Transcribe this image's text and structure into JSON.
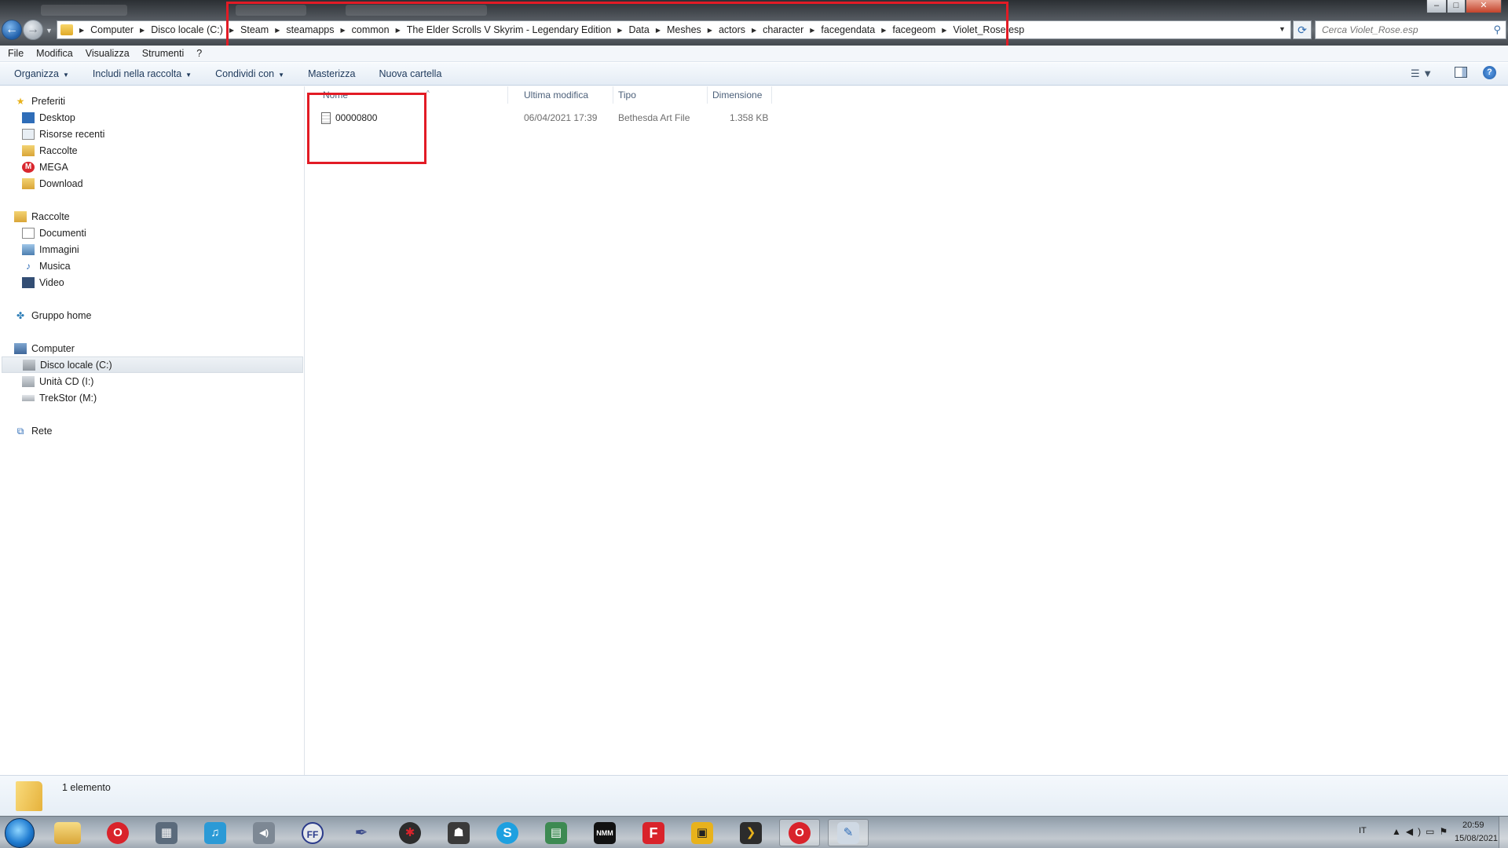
{
  "window": {
    "minimize": "–",
    "maximize": "□",
    "close": "✕"
  },
  "address": {
    "crumbs": [
      "Computer",
      "Disco locale (C:)",
      "Steam",
      "steamapps",
      "common",
      "The Elder Scrolls V Skyrim - Legendary Edition",
      "Data",
      "Meshes",
      "actors",
      "character",
      "facegendata",
      "facegeom",
      "Violet_Rose.esp"
    ],
    "search_placeholder": "Cerca Violet_Rose.esp"
  },
  "menu": [
    "File",
    "Modifica",
    "Visualizza",
    "Strumenti",
    "?"
  ],
  "commands": {
    "organize": "Organizza",
    "include": "Includi nella raccolta",
    "share": "Condividi con",
    "burn": "Masterizza",
    "new_folder": "Nuova cartella"
  },
  "nav": {
    "favorites": "Preferiti",
    "fav_items": [
      "Desktop",
      "Risorse recenti",
      "Raccolte",
      "MEGA",
      "Download"
    ],
    "libraries": "Raccolte",
    "lib_items": [
      "Documenti",
      "Immagini",
      "Musica",
      "Video"
    ],
    "homegroup": "Gruppo home",
    "computer": "Computer",
    "drives": [
      "Disco locale (C:)",
      "Unità CD (I:)",
      "TrekStor (M:)"
    ],
    "network": "Rete"
  },
  "columns": [
    "Nome",
    "Ultima modifica",
    "Tipo",
    "Dimensione"
  ],
  "files": [
    {
      "name": "00000800",
      "modified": "06/04/2021 17:39",
      "type": "Bethesda Art File",
      "size": "1.358 KB"
    }
  ],
  "status": {
    "count": "1 elemento"
  },
  "taskbar": {
    "lang": "IT",
    "time": "20:59",
    "date": "15/08/2021",
    "apps": [
      "opera-icon",
      "media-player-icon",
      "music-icon",
      "speaker-icon",
      "ffdec-icon",
      "feather-icon",
      "spider-icon",
      "figures-icon",
      "skype-icon",
      "notepad-icon",
      "nmm-icon",
      "flash-icon",
      "audio-icon",
      "arrow-icon",
      "opera-icon",
      "paint-icon"
    ],
    "app_labels": [
      "O",
      "▦",
      "♫",
      "◀)",
      "FF",
      "✒",
      "✱",
      "☗",
      "S",
      "▤",
      "NMM",
      "F",
      "▣",
      "❯",
      "O",
      "✎"
    ]
  },
  "colors": {
    "highlight": "#e21b25",
    "accent": "#1f5ea8"
  }
}
